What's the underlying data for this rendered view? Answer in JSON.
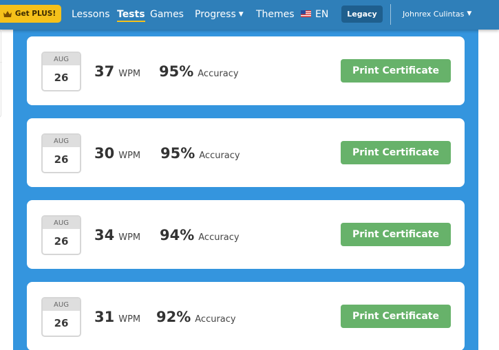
{
  "nav": {
    "plus_label": "Get PLUS!",
    "links": [
      "Lessons",
      "Tests",
      "Games",
      "Progress",
      "Themes"
    ],
    "active_link": "Tests",
    "language": "EN",
    "legacy_label": "Legacy",
    "user_name": "Johnrex Culintas"
  },
  "icons": {
    "plus": "crown-icon",
    "language": "us-flag-icon",
    "dropdown": "caret-down-icon"
  },
  "colors": {
    "navbar": "#2f7fb9",
    "plus_button": "#f5c11a",
    "panel": "#3495de",
    "print_button": "#67b26a"
  },
  "results": [
    {
      "month": "AUG",
      "day": "26",
      "wpm": "37",
      "wpm_unit": "WPM",
      "accuracy": "95%",
      "accuracy_label": "Accuracy",
      "button": "Print Certificate"
    },
    {
      "month": "AUG",
      "day": "26",
      "wpm": "30",
      "wpm_unit": "WPM",
      "accuracy": "95%",
      "accuracy_label": "Accuracy",
      "button": "Print Certificate"
    },
    {
      "month": "AUG",
      "day": "26",
      "wpm": "34",
      "wpm_unit": "WPM",
      "accuracy": "94%",
      "accuracy_label": "Accuracy",
      "button": "Print Certificate"
    },
    {
      "month": "AUG",
      "day": "26",
      "wpm": "31",
      "wpm_unit": "WPM",
      "accuracy": "92%",
      "accuracy_label": "Accuracy",
      "button": "Print Certificate"
    }
  ]
}
